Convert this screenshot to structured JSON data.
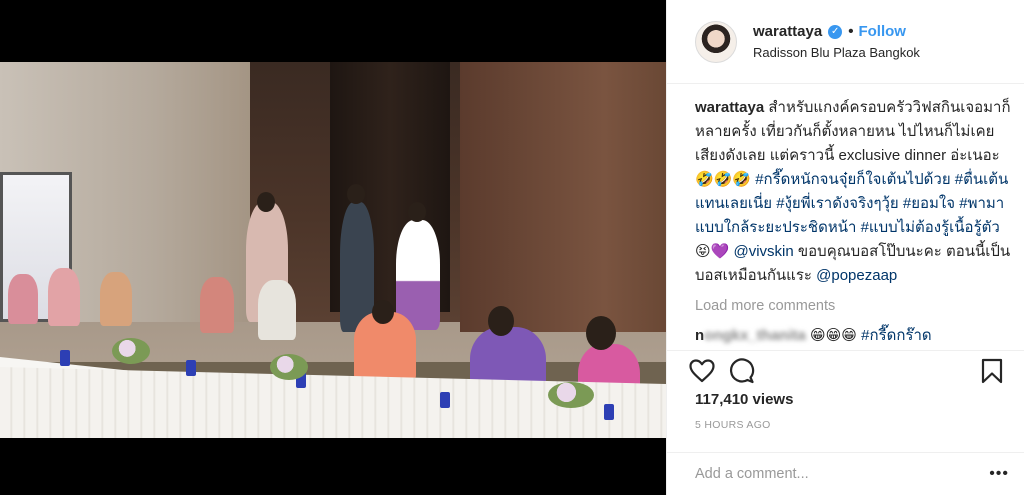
{
  "post": {
    "username": "warattaya",
    "follow_label": "Follow",
    "separator": "•",
    "verified_glyph": "✓",
    "location": "Radisson Blu Plaza Bangkok",
    "caption": {
      "username": "warattaya",
      "text_1": "สำหรับแกงค์ครอบครัววิฟสกินเจอมาก็หลายครั้ง เที่ยวกันก็ตั้งหลายหน ไปไหนก็ไม่เคยเสียงดังเลย แต่คราวนี้ exclusive dinner อ่ะเนอะ 🤣🤣🤣",
      "hashtag_1": "#กรี๊ดหนักจนจุ๋ยก็ใจเต้นไปด้วย",
      "hashtag_2": "#ตื่นเต้นแทนเลยเนี่ย",
      "hashtag_3": "#งุ้ยพี่เราดังจริงๆวุ้ย",
      "hashtag_4": "#ยอมใจ",
      "hashtag_5": "#พามาแบบใกล้ระยะประชิดหน้า",
      "hashtag_6": "#แบบไม่ต้องรู้เนื้อรู้ตัว",
      "emoji_2": "😝💜",
      "mention_1": "@vivskin",
      "text_2": "ขอบคุณบอสโป๊บนะคะ ตอนนี้เป็นบอสเหมือนกันแระ",
      "mention_2": "@popezaap"
    },
    "load_more_label": "Load more comments",
    "comment": {
      "username_visible": "n",
      "username_blurred": "ongkx_thanita",
      "emoji": "😁😁😁",
      "hashtag": "#กรี๊ดกร๊าด"
    },
    "icons": [
      "heart-icon",
      "comment-icon",
      "bookmark-icon",
      "more-dots-icon"
    ],
    "views": "117,410 views",
    "time_ago": "5 HOURS AGO",
    "add_comment_placeholder": "Add a comment...",
    "more_label": "•••",
    "colors": {
      "link": "#3897f0",
      "hashtag": "#003569",
      "muted": "#999999",
      "text": "#262626"
    }
  }
}
